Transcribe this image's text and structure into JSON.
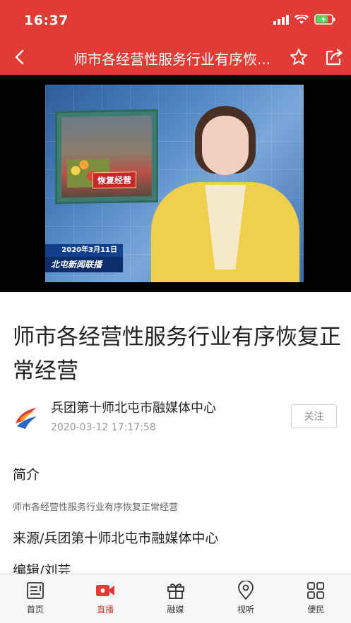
{
  "status_bar": {
    "time": "16:37"
  },
  "nav": {
    "title": "师市各经营性服务行业有序恢..."
  },
  "video": {
    "inset_caption": "恢复经营",
    "date": "2020年3月11日",
    "program": "北屯新闻联播"
  },
  "article": {
    "headline": "师市各经营性服务行业有序恢复正常经营",
    "source_name": "兵团第十师北屯市融媒体中心",
    "published": "2020-03-12 17:17:58",
    "follow_label": "关注",
    "intro_title": "简介",
    "summary": "师市各经营性服务行业有序恢复正常经营",
    "source_line": "来源/兵团第十师北屯市融媒体中心",
    "editor_line": "编辑/刘芸"
  },
  "tabs": [
    {
      "label": "首页",
      "icon": "home-icon"
    },
    {
      "label": "直播",
      "icon": "live-camera-icon"
    },
    {
      "label": "融媒",
      "icon": "gift-icon"
    },
    {
      "label": "视听",
      "icon": "location-icon"
    },
    {
      "label": "便民",
      "icon": "grid-icon"
    }
  ],
  "colors": {
    "brand": "#e23b36",
    "battery": "#4cd964"
  }
}
